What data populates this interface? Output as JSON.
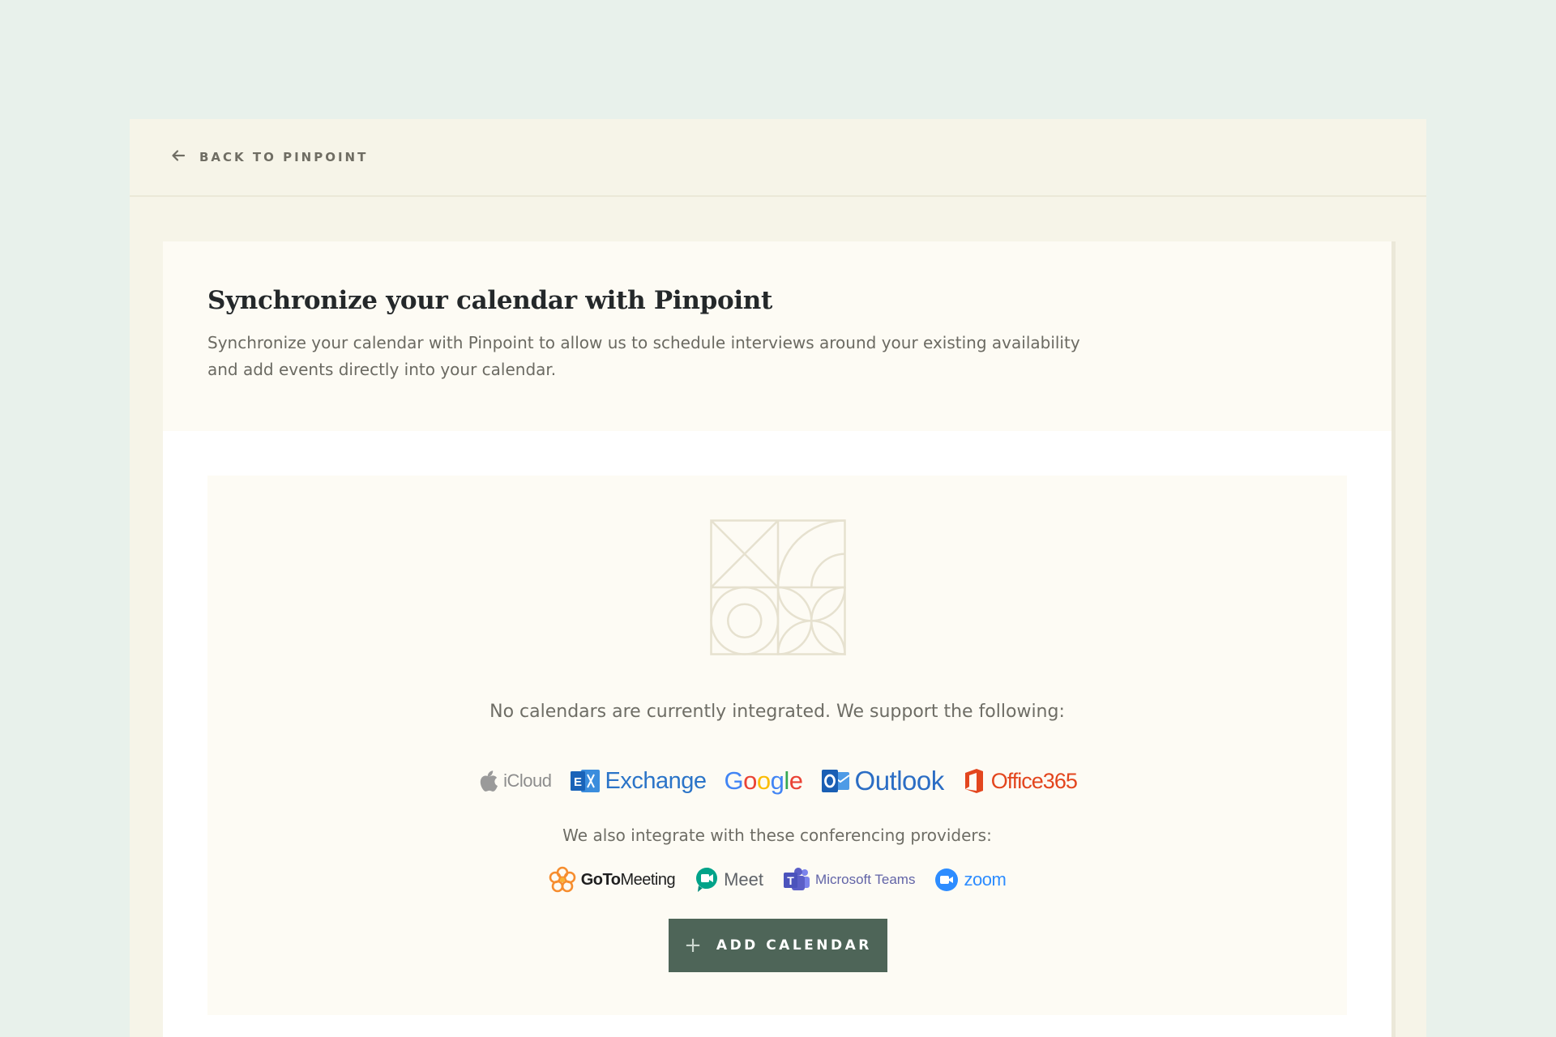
{
  "nav": {
    "back_label": "BACK TO PINPOINT"
  },
  "header": {
    "title": "Synchronize your calendar with Pinpoint",
    "description": "Synchronize your calendar with Pinpoint to allow us to schedule interviews around your existing availability and add events directly into your calendar."
  },
  "empty_state": {
    "message": "No calendars are currently integrated. We support the following:",
    "calendar_providers": [
      {
        "name": "iCloud",
        "icon": "apple-icon",
        "color": "#8a8a8a"
      },
      {
        "name": "Exchange",
        "icon": "exchange-icon",
        "color": "#2b74c8"
      },
      {
        "name": "Google",
        "icon": "google-wordmark",
        "color": "#4285f4"
      },
      {
        "name": "Outlook",
        "icon": "outlook-icon",
        "color": "#2b6dc4"
      },
      {
        "name": "Office 365",
        "icon": "office-icon",
        "color": "#e3461e"
      }
    ],
    "conferencing_message": "We also integrate with these conferencing providers:",
    "conferencing_providers": [
      {
        "name_bold": "GoTo",
        "name_rest": "Meeting",
        "icon": "gotomeeting-icon",
        "color": "#f68d2e"
      },
      {
        "name": "Meet",
        "icon": "google-meet-icon",
        "color": "#00897b"
      },
      {
        "name": "Microsoft Teams",
        "icon": "teams-icon",
        "color": "#5b5fc7"
      },
      {
        "name": "zoom",
        "icon": "zoom-icon",
        "color": "#2d8cff"
      }
    ],
    "add_button_label": "ADD CALENDAR"
  },
  "colors": {
    "page_bg": "#e8f1eb",
    "frame_bg": "#f6f4e8",
    "panel_bg": "#fdfbf4",
    "button_bg": "#4e6558"
  }
}
